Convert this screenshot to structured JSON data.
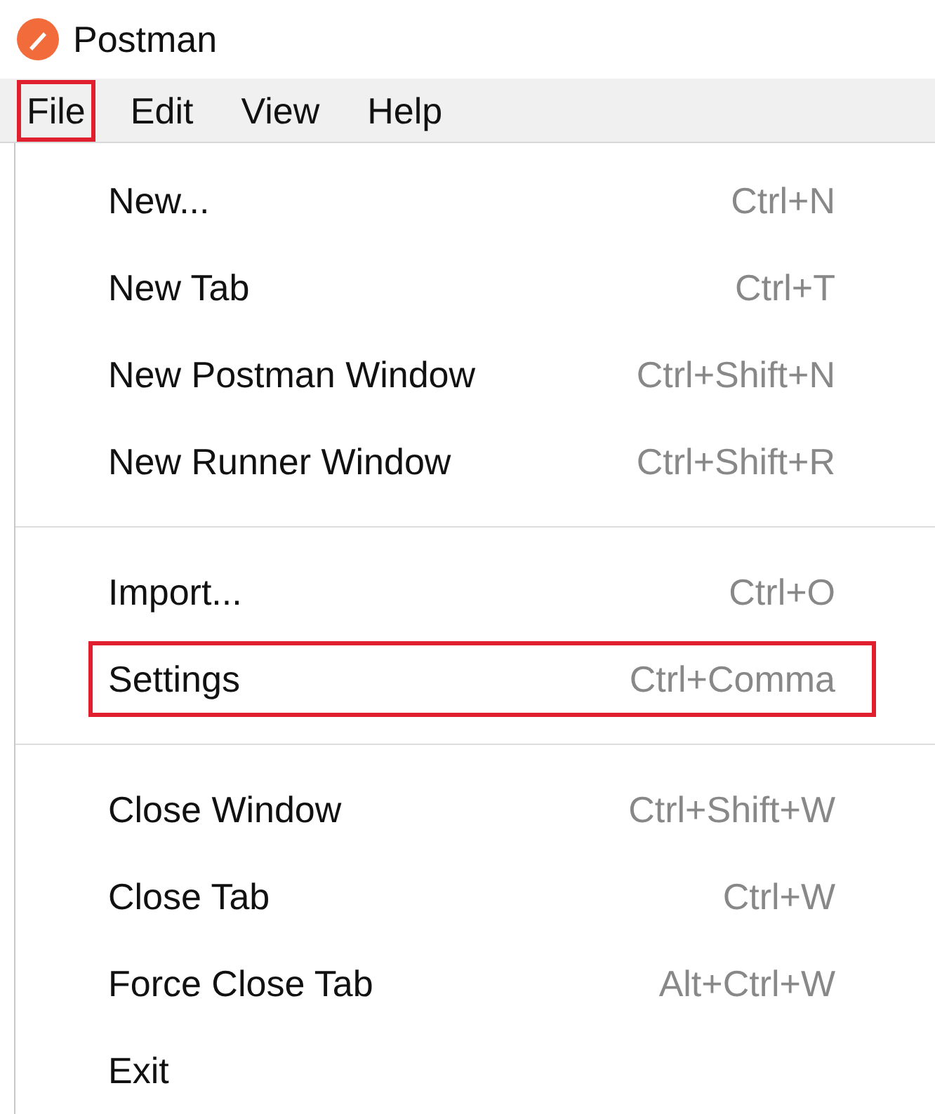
{
  "window": {
    "title": "Postman"
  },
  "menu_bar": [
    {
      "label": "File",
      "highlighted": true
    },
    {
      "label": "Edit",
      "highlighted": false
    },
    {
      "label": "View",
      "highlighted": false
    },
    {
      "label": "Help",
      "highlighted": false
    }
  ],
  "menu": {
    "groups": [
      {
        "items": [
          {
            "label": "New...",
            "shortcut": "Ctrl+N",
            "highlighted": false
          },
          {
            "label": "New Tab",
            "shortcut": "Ctrl+T",
            "highlighted": false
          },
          {
            "label": "New Postman Window",
            "shortcut": "Ctrl+Shift+N",
            "highlighted": false
          },
          {
            "label": "New Runner Window",
            "shortcut": "Ctrl+Shift+R",
            "highlighted": false
          }
        ]
      },
      {
        "items": [
          {
            "label": "Import...",
            "shortcut": "Ctrl+O",
            "highlighted": false
          },
          {
            "label": "Settings",
            "shortcut": "Ctrl+Comma",
            "highlighted": true
          }
        ]
      },
      {
        "items": [
          {
            "label": "Close Window",
            "shortcut": "Ctrl+Shift+W",
            "highlighted": false
          },
          {
            "label": "Close Tab",
            "shortcut": "Ctrl+W",
            "highlighted": false
          },
          {
            "label": "Force Close Tab",
            "shortcut": "Alt+Ctrl+W",
            "highlighted": false
          },
          {
            "label": "Exit",
            "highlighted": false
          }
        ]
      }
    ]
  }
}
